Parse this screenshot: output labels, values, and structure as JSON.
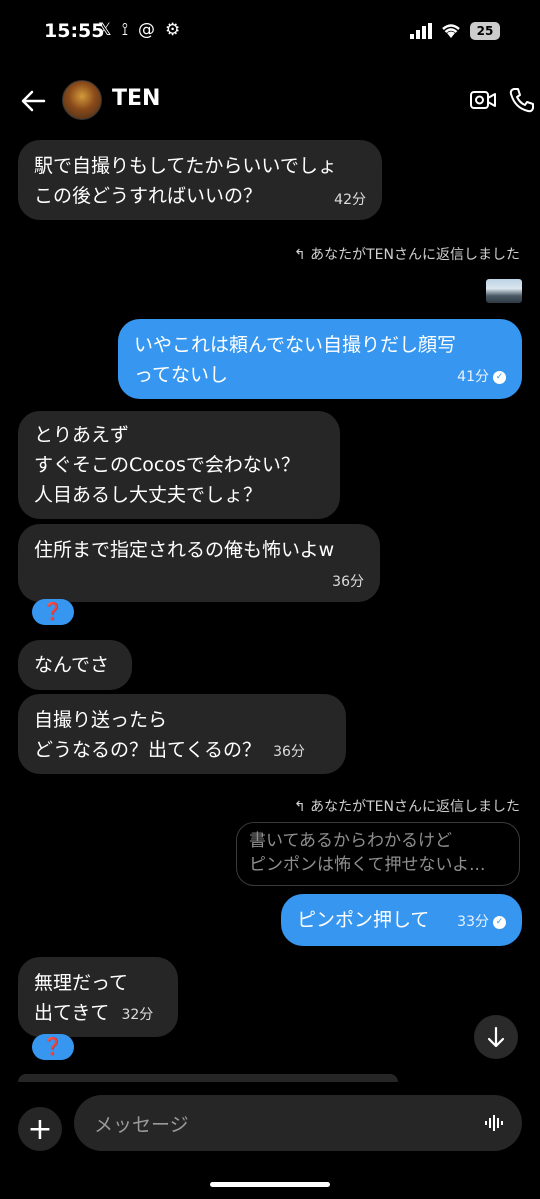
{
  "status_bar": {
    "time": "15:55",
    "battery": "25"
  },
  "header": {
    "title": "TEN"
  },
  "messages": [
    {
      "lines": [
        "駅で自撮りもしてたからいいでしょ",
        "この後どうすればいいの？"
      ],
      "time": "42分"
    },
    {
      "reply_label": "あなたがTENさんに返信しました"
    },
    {
      "lines": [
        "いやこれは頼んでない自撮りだし顔写",
        "ってないし"
      ],
      "time": "41分"
    },
    {
      "lines": [
        "とりあえず",
        "すぐそこのCocosで会わない？",
        "人目あるし大丈夫でしょ？"
      ]
    },
    {
      "lines": [
        "住所まで指定されるの俺も怖いよw"
      ],
      "time": "36分",
      "reaction": "❓"
    },
    {
      "lines": [
        "なんでさ"
      ]
    },
    {
      "lines": [
        "自撮り送ったら",
        "どうなるの？出てくるの？"
      ],
      "time": "36分"
    },
    {
      "reply_label": "あなたがTENさんに返信しました",
      "quoted": [
        "書いてあるからわかるけど",
        "ピンポンは怖くて押せないよ..."
      ]
    },
    {
      "lines": [
        "ピンポン押して"
      ],
      "time": "33分"
    },
    {
      "lines": [
        "無理だって",
        "出てきて"
      ],
      "time": "32分",
      "reaction": "❓"
    }
  ],
  "composer": {
    "placeholder": "メッセージ"
  },
  "colors": {
    "sent": "#3797f0",
    "received": "#262626",
    "background": "#000000"
  }
}
